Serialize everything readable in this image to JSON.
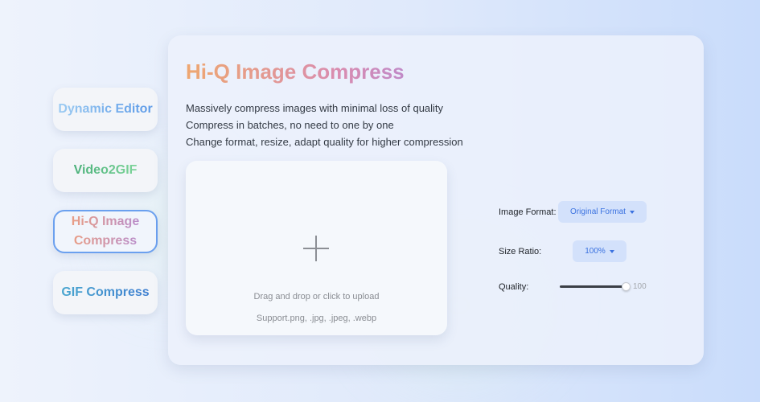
{
  "sidebar": {
    "items": [
      {
        "label": "Dynamic Editor",
        "selected": false
      },
      {
        "label": "Video2GIF",
        "selected": false
      },
      {
        "label": "Hi-Q Image Compress",
        "selected": true
      },
      {
        "label": "GIF Compress",
        "selected": false
      }
    ]
  },
  "main": {
    "title": "Hi-Q Image Compress",
    "features": [
      "Massively compress images with minimal loss of quality",
      "Compress in batches, no need to one by one",
      "Change format, resize, adapt quality for higher compression"
    ],
    "upload": {
      "icon": "plus-icon",
      "hint": "Drag and drop or click to upload",
      "support": "Support.png, .jpg, .jpeg, .webp"
    },
    "options": {
      "format": {
        "label": "Image Format:",
        "value": "Original Format"
      },
      "ratio": {
        "label": "Size Ratio:",
        "value": "100%"
      },
      "quality": {
        "label": "Quality:",
        "value": 100,
        "max": 100,
        "value_text": "100"
      }
    }
  },
  "colors": {
    "accent": "#3b72e0",
    "selected_border": "#6ba0ef"
  }
}
